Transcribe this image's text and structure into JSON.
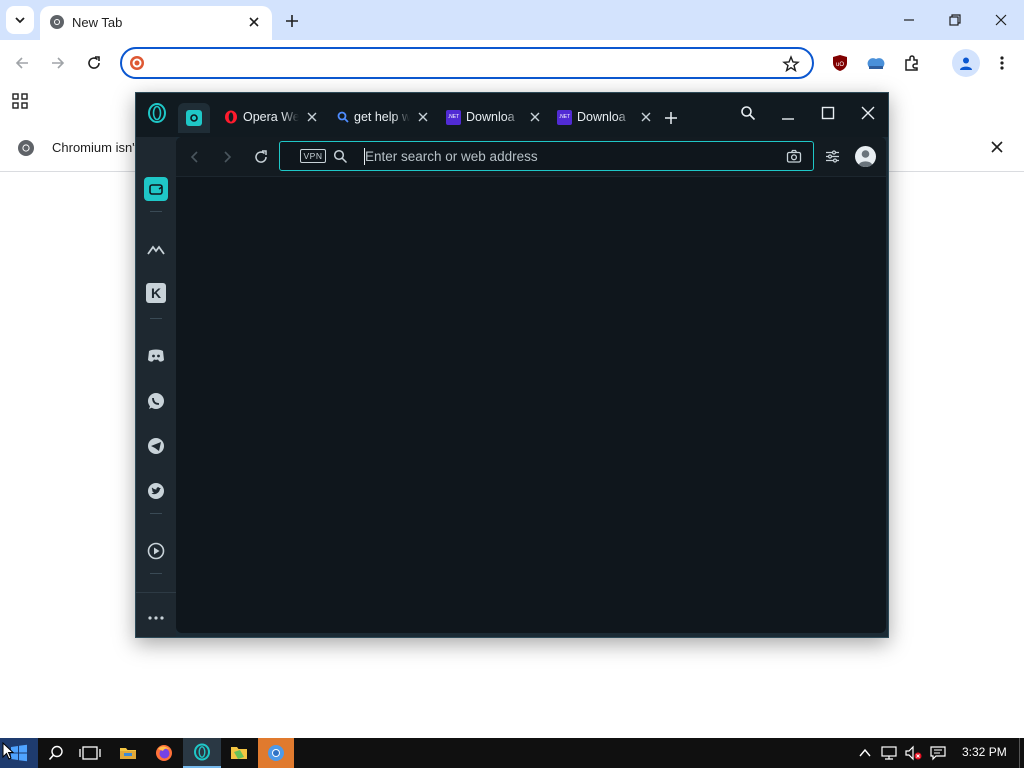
{
  "chromium": {
    "tab": {
      "title": "New Tab"
    },
    "omnibox": {
      "value": ""
    },
    "infobar": {
      "text": "Chromium isn't"
    },
    "accent": "#0b57d0"
  },
  "opera": {
    "tabs": [
      {
        "title": "",
        "icon": "opera-workspace-icon",
        "active": true
      },
      {
        "title": "Opera We",
        "icon": "opera-logo-icon"
      },
      {
        "title": "get help w",
        "icon": "search-icon"
      },
      {
        "title": "Downloa",
        "icon": "dotnet-icon"
      },
      {
        "title": "Downloa",
        "icon": "dotnet-icon"
      }
    ],
    "address": {
      "placeholder": "Enter search or web address",
      "vpn_label": "VPN"
    },
    "sidebar": [
      "my-flow-icon",
      "aria-icon",
      "kakao-icon",
      "discord-icon",
      "whatsapp-icon",
      "telegram-icon",
      "twitter-icon",
      "player-icon",
      "more-icon"
    ],
    "accent": "#1fc7c7"
  },
  "taskbar": {
    "clock": "3:32 PM",
    "apps": [
      "start-icon",
      "search-icon",
      "task-view-icon",
      "file-explorer-icon",
      "firefox-icon",
      "opera-icon",
      "files-icon",
      "chromium-icon"
    ]
  }
}
